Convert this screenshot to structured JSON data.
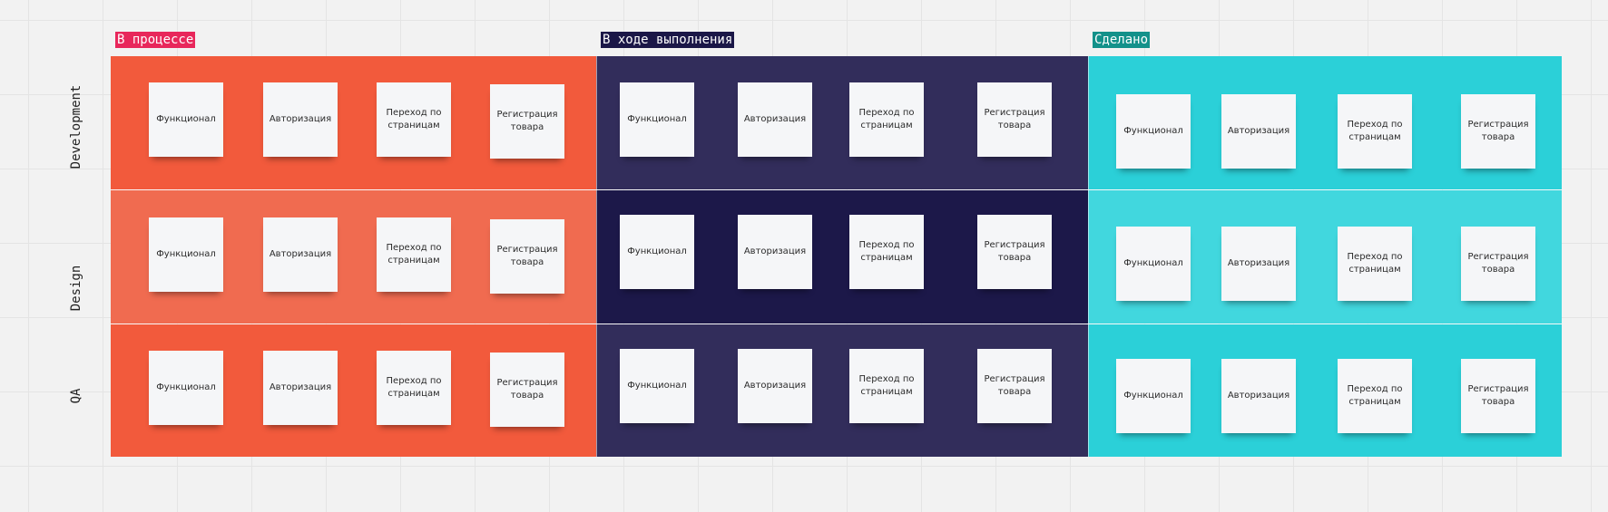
{
  "columns": [
    {
      "label": "В процессе",
      "tag_color": "#e8275b",
      "cell_colors": [
        "#f25a3c",
        "#f06b50",
        "#f25a3c"
      ]
    },
    {
      "label": "В ходе выполнения",
      "tag_color": "#1b1747",
      "cell_colors": [
        "#322d5b",
        "#1c1849",
        "#322d5b"
      ]
    },
    {
      "label": "Сделано",
      "tag_color": "#13918a",
      "cell_colors": [
        "#2bd0d8",
        "#41d7de",
        "#2bd0d8"
      ]
    }
  ],
  "rows": [
    "Development",
    "Design",
    "QA"
  ],
  "notes": [
    "Функционал",
    "Авторизация",
    "Переход по страницам",
    "Регистрация товара"
  ]
}
